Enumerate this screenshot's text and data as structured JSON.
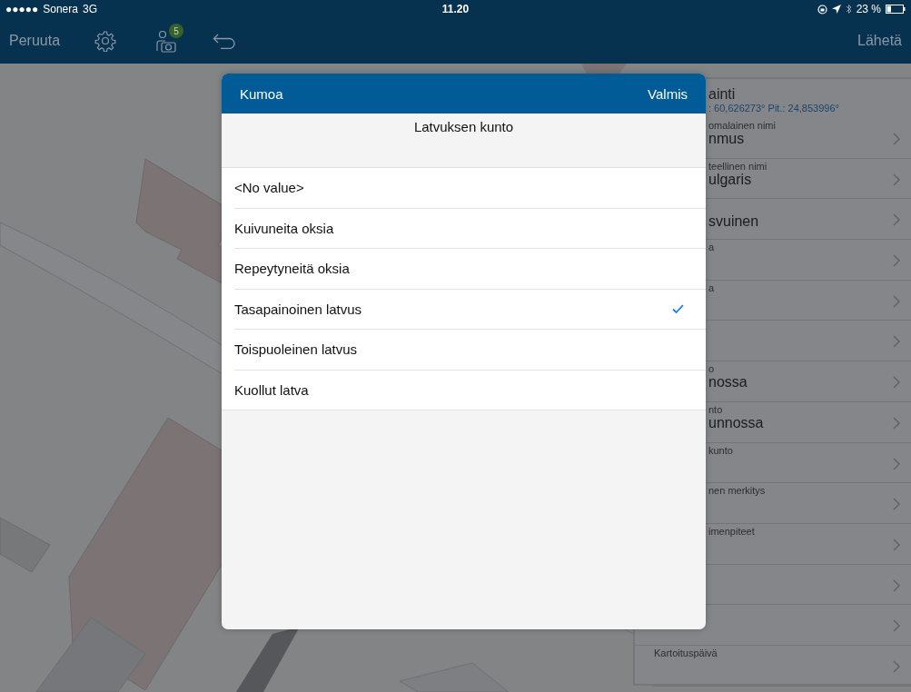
{
  "status_bar": {
    "signal": "●●●●●",
    "carrier": "Sonera",
    "network": "3G",
    "time": "11.20",
    "battery": "23 %"
  },
  "nav_bar": {
    "cancel": "Peruuta",
    "badge": "5",
    "send": "Lähetä"
  },
  "details_panel": {
    "title": "ainti",
    "coordinates": ": 60,626273° Pit.: 24,853996°",
    "rows": [
      {
        "label": "omalainen nimi",
        "value": "nmus"
      },
      {
        "label": "teellinen nimi",
        "value": "ulgaris"
      },
      {
        "value": "svuinen"
      },
      {
        "label": "a"
      },
      {
        "label": "a"
      },
      {},
      {
        "label": "o",
        "value": "nossa"
      },
      {
        "label": "nto",
        "value": "unnossa"
      },
      {
        "label": "kunto"
      },
      {
        "label": "nen merkitys"
      },
      {
        "label": "imenpiteet"
      },
      {},
      {},
      {
        "label": "Kartoituspäivä"
      }
    ]
  },
  "picker": {
    "cancel": "Kumoa",
    "done": "Valmis",
    "title": "Latvuksen kunto",
    "options": [
      {
        "label": "<No value>",
        "selected": false
      },
      {
        "label": "Kuivuneita oksia",
        "selected": false
      },
      {
        "label": "Repeytyneitä oksia",
        "selected": false
      },
      {
        "label": "Tasapainoinen latvus",
        "selected": true
      },
      {
        "label": "Toispuoleinen latvus",
        "selected": false
      },
      {
        "label": "Kuollut latva",
        "selected": false
      }
    ]
  }
}
